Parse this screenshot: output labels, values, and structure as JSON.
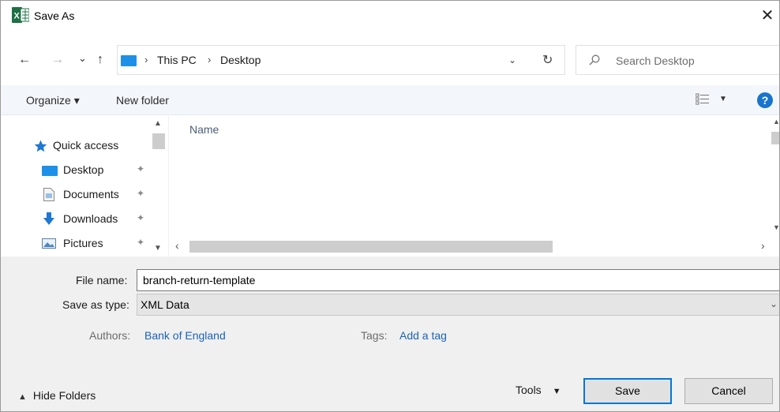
{
  "window": {
    "title": "Save As",
    "close_glyph": "✕",
    "app_icon": "excel-icon"
  },
  "nav": {
    "back": "←",
    "forward": "→",
    "recent": "⌄",
    "up": "↑",
    "breadcrumb": [
      "This PC",
      "Desktop"
    ],
    "crumb_sep": "›",
    "dropdown": "⌄",
    "refresh": "↻",
    "search_placeholder": "Search Desktop"
  },
  "toolbar": {
    "organize": "Organize ▾",
    "new_folder": "New folder",
    "view_icon": "view-list-icon",
    "view_dd": "▼",
    "help": "?"
  },
  "nav_pane": {
    "items": [
      {
        "label": "Quick access",
        "icon": "star-icon"
      },
      {
        "label": "Desktop",
        "icon": "desktop-icon"
      },
      {
        "label": "Documents",
        "icon": "documents-icon"
      },
      {
        "label": "Downloads",
        "icon": "downloads-icon"
      },
      {
        "label": "Pictures",
        "icon": "pictures-icon"
      }
    ],
    "pin_glyph": "✦"
  },
  "file_list": {
    "column_name": "Name"
  },
  "form": {
    "file_name_label": "File name:",
    "file_name_value": "branch-return-template",
    "save_type_label": "Save as type:",
    "save_type_value": "XML Data",
    "authors_label": "Authors:",
    "authors_value": "Bank of England",
    "tags_label": "Tags:",
    "tags_value": "Add a tag"
  },
  "footer": {
    "hide_folders": "Hide Folders",
    "tools": "Tools",
    "save": "Save",
    "cancel": "Cancel"
  },
  "colors": {
    "accent": "#0078d7",
    "link": "#1a63b8",
    "excel_green": "#1d7044"
  }
}
